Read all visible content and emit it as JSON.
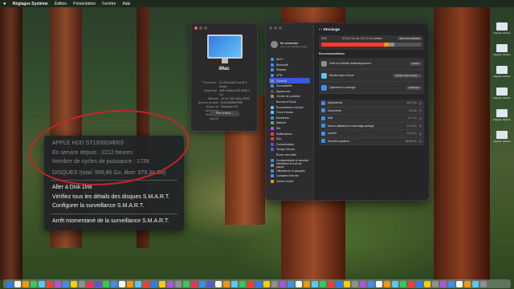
{
  "menubar": {
    "items": [
      "Réglages Système",
      "Édition",
      "Présentation",
      "Fenêtre",
      "Aide"
    ]
  },
  "about": {
    "model": "iMac",
    "rows": [
      [
        "Processeur",
        "3,2 GHz Intel Core i5 4 cœurs"
      ],
      [
        "Graphisme",
        "AMD Radeon R9 M390 2 Go"
      ],
      [
        "Mémoire",
        "16 Go 1867 MHz DDR3"
      ],
      [
        "Numéro de série",
        "DGKQ50NNF9RP"
      ],
      [
        "Disque de démarrage",
        "Macintosh HD"
      ],
      [
        "Version de macOS",
        "Sonoma 14.x"
      ]
    ],
    "more_button": "Plus d'infos…"
  },
  "settings": {
    "title": "Stockage",
    "user": "Se connecter",
    "user_sub": "avec votre identifiant Apple",
    "sidebar": [
      {
        "label": "Wi-Fi",
        "color": "#3d8ef0"
      },
      {
        "label": "Bluetooth",
        "color": "#3d8ef0"
      },
      {
        "label": "Réseau",
        "color": "#3d8ef0"
      },
      {
        "label": "VPN",
        "color": "#3d8ef0"
      },
      {
        "label": "Général",
        "color": "#8e8e93",
        "selected": true
      },
      {
        "label": "Accessibilité",
        "color": "#3d8ef0"
      },
      {
        "label": "Apparence",
        "color": "#555"
      },
      {
        "label": "Centre de contrôle",
        "color": "#8e8e93"
      },
      {
        "label": "Bureau et Dock",
        "color": "#333"
      },
      {
        "label": "Économiseur d'écran",
        "color": "#5ac8fa"
      },
      {
        "label": "Fond d'écran",
        "color": "#5ac8fa"
      },
      {
        "label": "Moniteurs",
        "color": "#3d8ef0"
      },
      {
        "label": "Batterie",
        "color": "#34c759"
      },
      {
        "label": "Siri",
        "color": "#af52de"
      },
      {
        "label": "Notifications",
        "color": "#ff3b30"
      },
      {
        "label": "Son",
        "color": "#ff2d55"
      },
      {
        "label": "Concentration",
        "color": "#5856d6"
      },
      {
        "label": "Temps d'écran",
        "color": "#5856d6"
      },
      {
        "label": "Écran verrouillé",
        "color": "#333"
      },
      {
        "label": "Confidentialité et sécurité",
        "color": "#3d8ef0"
      },
      {
        "label": "Identifiant et mot de passe",
        "color": "#8e8e93"
      },
      {
        "label": "Utilisateurs et groupes",
        "color": "#3d8ef0"
      },
      {
        "label": "Comptes Internet",
        "color": "#3d8ef0"
      },
      {
        "label": "Game Center",
        "color": "#ff9500"
      }
    ],
    "disk": {
      "name": "SSD",
      "usage": "874,47 Go sur 121,72 Go utilisés",
      "button": "Tous les volumes",
      "segments": [
        {
          "color": "#ff3b30",
          "fraction": 0.62
        },
        {
          "color": "#ff9500",
          "fraction": 0.05
        },
        {
          "color": "#8e8e93",
          "fraction": 0.06
        }
      ]
    },
    "recommendations_title": "Recommandations",
    "recommendations": [
      {
        "title": "Vider la corbeille automatiquement",
        "button": "Activer",
        "color": "#8e8e93"
      },
      {
        "title": "Stocker dans iCloud",
        "button": "Stocker dans iCloud…",
        "color": "#5ac8fa"
      },
      {
        "title": "Optimiser le stockage",
        "button": "Optimiser",
        "color": "#3d8ef0"
      }
    ],
    "list": [
      {
        "label": "Applications",
        "size": "18,2 Go"
      },
      {
        "label": "Documents",
        "size": "7,6 Go"
      },
      {
        "label": "Mail",
        "size": "2,1 Go"
      },
      {
        "label": "Autres utilisateurs et stockage partagé",
        "size": "27,4 Go"
      },
      {
        "label": "macOS",
        "size": "21,5 Go"
      },
      {
        "label": "Données système",
        "size": "26,96 Go"
      }
    ]
  },
  "context_menu": {
    "disk_name": "APPLE HDD ST1000DM003",
    "hours": "En service depuis : 2212 heures",
    "cycles": "Nombre de cycles de puissance : 1739",
    "disk_line": "DISQUES (total: 999,86 Go, libre: 979,34 Go)",
    "items": [
      "Aller à Disk Drill",
      "Vérifiez tous les détails des disques S.M.A.R.T.",
      "Configurer la surveillance S.M.A.R.T.",
      "Arrêt momentané de la surveillance S.M.A.R.T."
    ]
  },
  "desktop_icons": [
    "Capture d'écran",
    "Capture d'écran",
    "Capture d'écran",
    "Capture d'écran",
    "Capture d'écran",
    "Capture d'écran"
  ],
  "dock_colors": [
    "#2d7cf6",
    "#f5f5f5",
    "#ff9500",
    "#34c759",
    "#5ac8fa",
    "#ff3b30",
    "#af52de",
    "#3d8ef0",
    "#ffcc00",
    "#8e8e93",
    "#ff2d55",
    "#5856d6",
    "#34c759",
    "#3d8ef0",
    "#f5f5f5",
    "#ff9500",
    "#5ac8fa",
    "#ff3b30",
    "#2d7cf6",
    "#ffcc00",
    "#af52de",
    "#8e8e93",
    "#34c759",
    "#ff2d55",
    "#3d8ef0",
    "#5856d6",
    "#f5f5f5",
    "#ff9500",
    "#5ac8fa",
    "#34c759",
    "#ff3b30",
    "#2d7cf6",
    "#ffcc00",
    "#8e8e93",
    "#af52de",
    "#3d8ef0",
    "#f5f5f5",
    "#ff9500",
    "#5ac8fa",
    "#34c759",
    "#ff3b30",
    "#2d7cf6",
    "#ffcc00",
    "#8e8e93",
    "#af52de",
    "#3d8ef0",
    "#f5f5f5",
    "#ff9500",
    "#5ac8fa",
    "#34c759",
    "#ff3b30",
    "#2d7cf6",
    "#ffcc00",
    "#8e8e93",
    "#af52de",
    "#3d8ef0",
    "#f5f5f5",
    "#ff9500",
    "#5ac8fa",
    "#8e8e93"
  ]
}
